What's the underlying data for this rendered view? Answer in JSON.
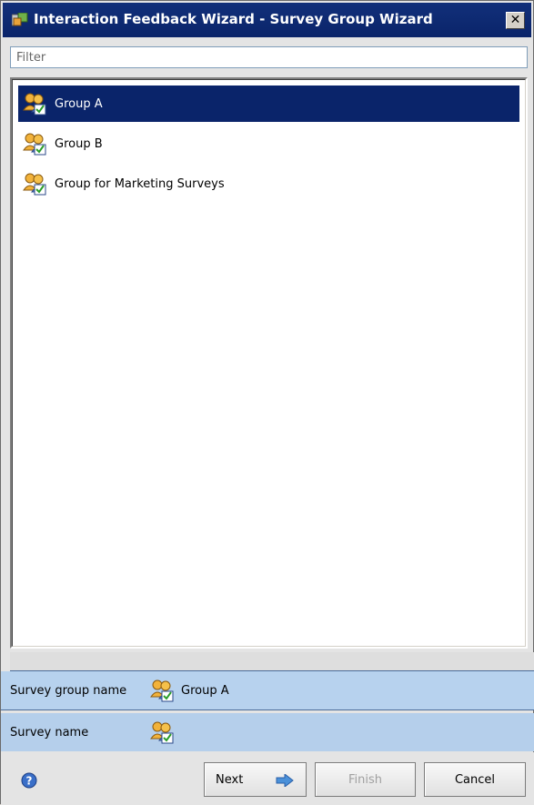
{
  "window": {
    "title": "Interaction Feedback Wizard - Survey Group Wizard",
    "close_label": "✕"
  },
  "filter": {
    "placeholder": "Filter",
    "value": ""
  },
  "groups": [
    {
      "label": "Group A",
      "selected": true
    },
    {
      "label": "Group B",
      "selected": false
    },
    {
      "label": "Group for Marketing Surveys",
      "selected": false
    }
  ],
  "properties": {
    "survey_group_name_label": "Survey group name",
    "survey_group_name_value": "Group A",
    "survey_name_label": "Survey name",
    "survey_name_value": ""
  },
  "footer": {
    "next_label": "Next",
    "finish_label": "Finish",
    "cancel_label": "Cancel",
    "help_icon": "help-icon",
    "finish_enabled": false
  },
  "colors": {
    "selection": "#0a246a",
    "title_bar": "#0a246a",
    "property_bg": "#b7d2ee",
    "next_arrow": "#4a90d9"
  }
}
